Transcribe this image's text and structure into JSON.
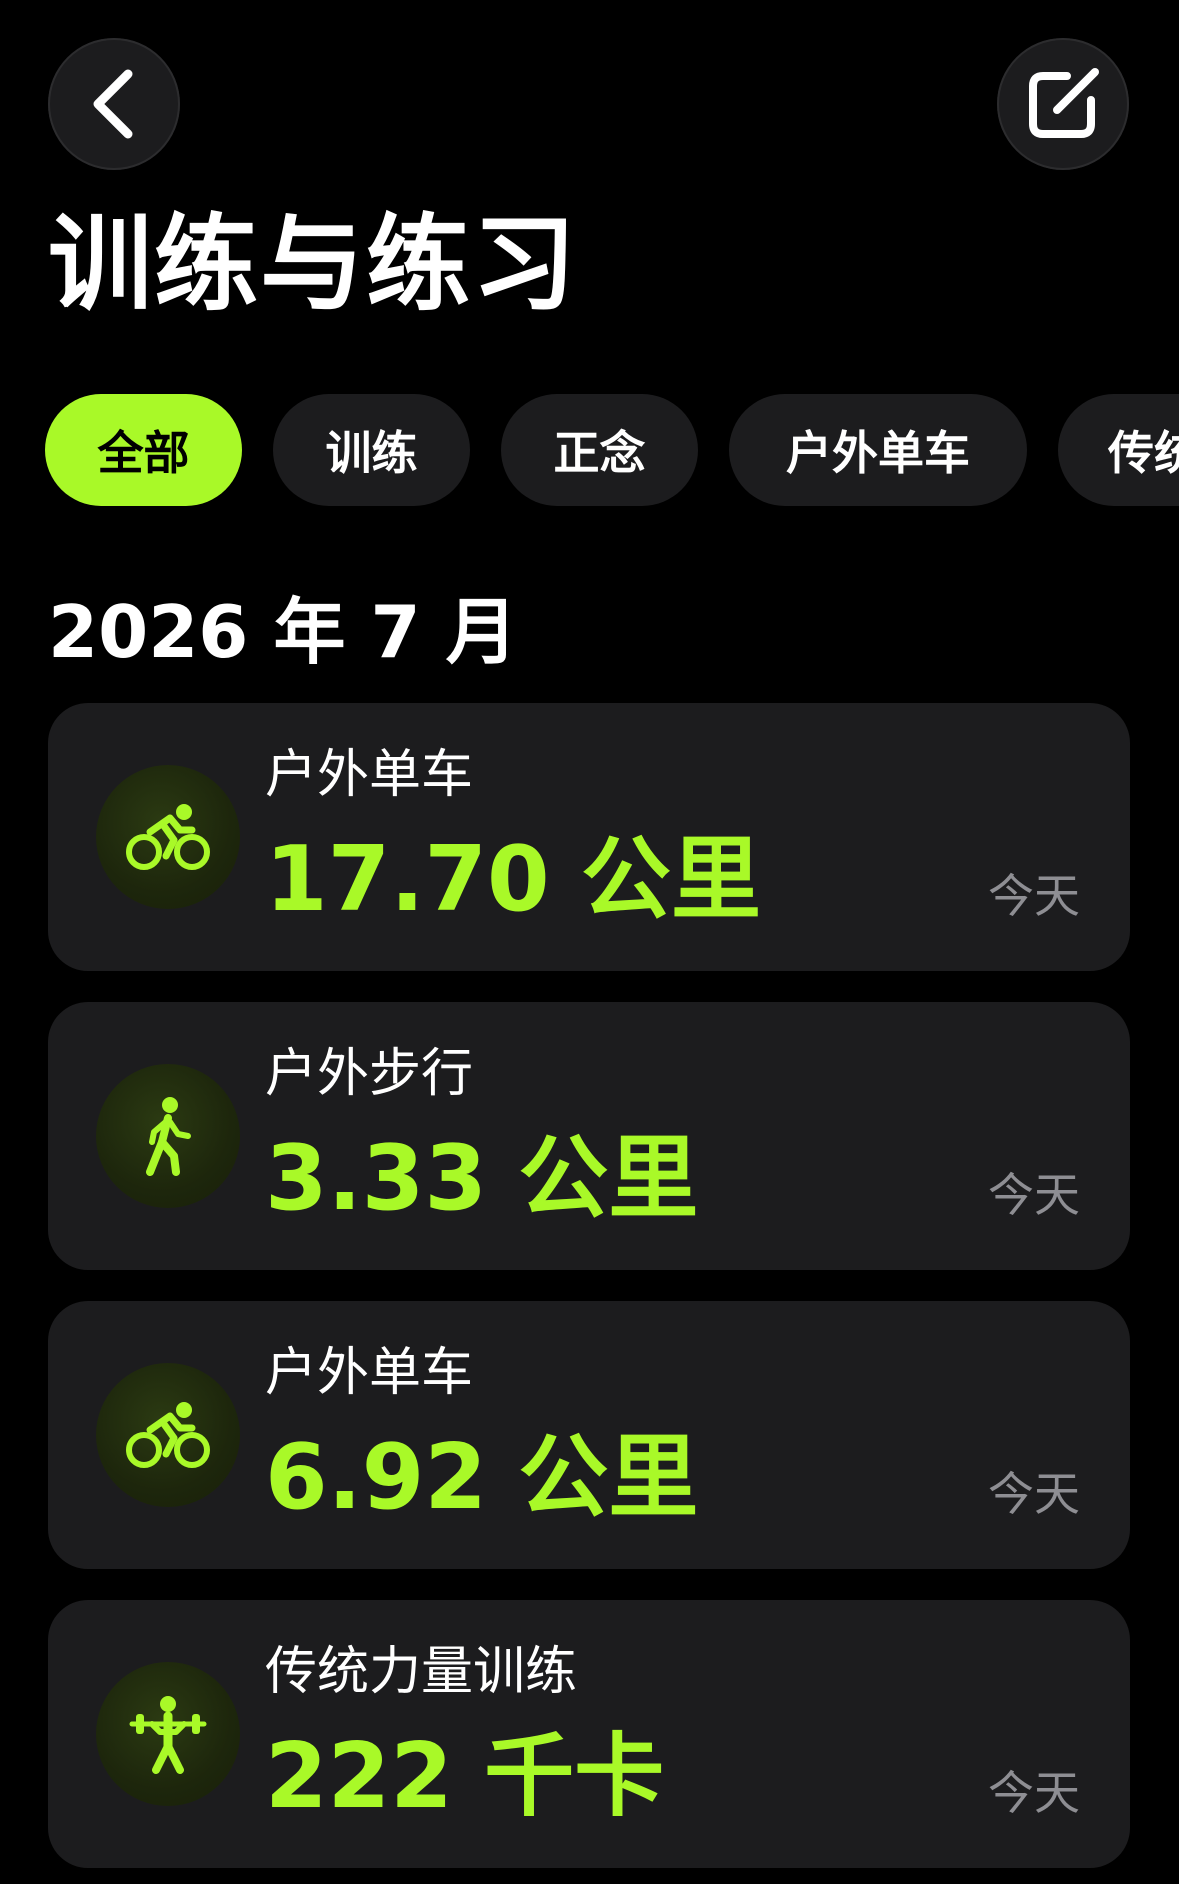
{
  "header": {
    "title": "训练与练习",
    "back_icon": "chevron-left-icon",
    "edit_icon": "edit-icon"
  },
  "filters": [
    {
      "label": "全部",
      "active": true
    },
    {
      "label": "训练",
      "active": false
    },
    {
      "label": "正念",
      "active": false
    },
    {
      "label": "户外单车",
      "active": false
    },
    {
      "label": "传统",
      "active": false
    }
  ],
  "section": {
    "heading": "2026 年 7 月"
  },
  "workouts": [
    {
      "type": "户外单车",
      "value": "17.70 公里",
      "date": "今天",
      "icon": "cycling-icon"
    },
    {
      "type": "户外步行",
      "value": "3.33 公里",
      "date": "今天",
      "icon": "walking-icon"
    },
    {
      "type": "户外单车",
      "value": "6.92 公里",
      "date": "今天",
      "icon": "cycling-icon"
    },
    {
      "type": "传统力量训练",
      "value": "222 千卡",
      "date": "今天",
      "icon": "weightlifting-icon"
    }
  ],
  "colors": {
    "background": "#000000",
    "card": "#1c1c1e",
    "accent": "#a9f928",
    "secondary_text": "#8e8e93"
  }
}
